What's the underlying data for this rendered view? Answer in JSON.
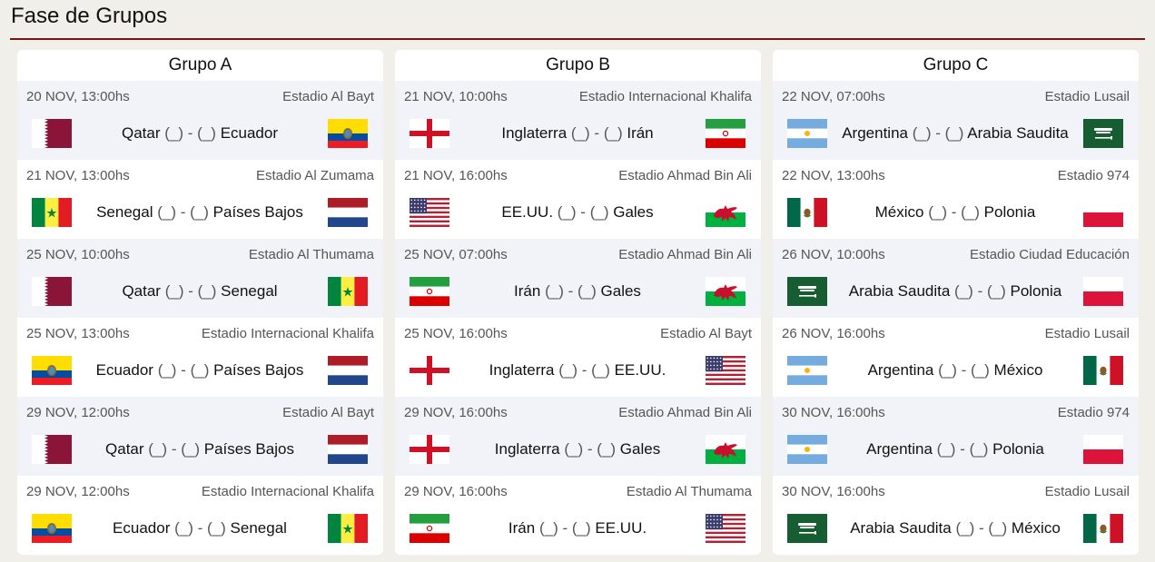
{
  "header": {
    "title": "Fase de Grupos"
  },
  "groups": [
    {
      "name": "Grupo A",
      "matches": [
        {
          "datetime": "20 NOV, 13:00hs",
          "stadium": "Estadio Al Bayt",
          "home": "Qatar",
          "away": "Ecuador",
          "home_flag": "qatar",
          "away_flag": "ecuador"
        },
        {
          "datetime": "21 NOV, 13:00hs",
          "stadium": "Estadio Al Zumama",
          "home": "Senegal",
          "away": "Países Bajos",
          "home_flag": "senegal",
          "away_flag": "netherlands"
        },
        {
          "datetime": "25 NOV, 10:00hs",
          "stadium": "Estadio Al Thumama",
          "home": "Qatar",
          "away": "Senegal",
          "home_flag": "qatar",
          "away_flag": "senegal"
        },
        {
          "datetime": "25 NOV, 13:00hs",
          "stadium": "Estadio Internacional Khalifa",
          "home": "Ecuador",
          "away": "Países Bajos",
          "home_flag": "ecuador",
          "away_flag": "netherlands"
        },
        {
          "datetime": "29 NOV, 12:00hs",
          "stadium": "Estadio Al Bayt",
          "home": "Qatar",
          "away": "Países Bajos",
          "home_flag": "qatar",
          "away_flag": "netherlands"
        },
        {
          "datetime": "29 NOV, 12:00hs",
          "stadium": "Estadio Internacional Khalifa",
          "home": "Ecuador",
          "away": "Senegal",
          "home_flag": "ecuador",
          "away_flag": "senegal"
        }
      ]
    },
    {
      "name": "Grupo B",
      "matches": [
        {
          "datetime": "21 NOV, 10:00hs",
          "stadium": "Estadio Internacional Khalifa",
          "home": "Inglaterra",
          "away": "Irán",
          "home_flag": "england",
          "away_flag": "iran"
        },
        {
          "datetime": "21 NOV, 16:00hs",
          "stadium": "Estadio Ahmad Bin Ali",
          "home": "EE.UU.",
          "away": "Gales",
          "home_flag": "usa",
          "away_flag": "wales"
        },
        {
          "datetime": "25 NOV, 07:00hs",
          "stadium": "Estadio Ahmad Bin Ali",
          "home": "Irán",
          "away": "Gales",
          "home_flag": "iran",
          "away_flag": "wales"
        },
        {
          "datetime": "25 NOV, 16:00hs",
          "stadium": "Estadio Al Bayt",
          "home": "Inglaterra",
          "away": "EE.UU.",
          "home_flag": "england",
          "away_flag": "usa"
        },
        {
          "datetime": "29 NOV, 16:00hs",
          "stadium": "Estadio Ahmad Bin Ali",
          "home": "Inglaterra",
          "away": "Gales",
          "home_flag": "england",
          "away_flag": "wales"
        },
        {
          "datetime": "29 NOV, 16:00hs",
          "stadium": "Estadio Al Thumama",
          "home": "Irán",
          "away": "EE.UU.",
          "home_flag": "iran",
          "away_flag": "usa"
        }
      ]
    },
    {
      "name": "Grupo C",
      "matches": [
        {
          "datetime": "22 NOV, 07:00hs",
          "stadium": "Estadio Lusail",
          "home": "Argentina",
          "away": "Arabia Saudita",
          "home_flag": "argentina",
          "away_flag": "saudi"
        },
        {
          "datetime": "22 NOV, 13:00hs",
          "stadium": "Estadio 974",
          "home": "México",
          "away": "Polonia",
          "home_flag": "mexico",
          "away_flag": "poland"
        },
        {
          "datetime": "26 NOV, 10:00hs",
          "stadium": "Estadio Ciudad Educación",
          "home": "Arabia Saudita",
          "away": "Polonia",
          "home_flag": "saudi",
          "away_flag": "poland"
        },
        {
          "datetime": "26 NOV, 16:00hs",
          "stadium": "Estadio Lusail",
          "home": "Argentina",
          "away": "México",
          "home_flag": "argentina",
          "away_flag": "mexico"
        },
        {
          "datetime": "30 NOV, 16:00hs",
          "stadium": "Estadio 974",
          "home": "Argentina",
          "away": "Polonia",
          "home_flag": "argentina",
          "away_flag": "poland"
        },
        {
          "datetime": "30 NOV, 16:00hs",
          "stadium": "Estadio Lusail",
          "home": "Arabia Saudita",
          "away": "México",
          "home_flag": "saudi",
          "away_flag": "mexico"
        }
      ]
    }
  ],
  "score_placeholder": "(_)",
  "score_separator": "-",
  "colors": {
    "accent_rule": "#7a1414",
    "odd_row": "#f1f3f8",
    "page_bg": "#f0efe9"
  }
}
